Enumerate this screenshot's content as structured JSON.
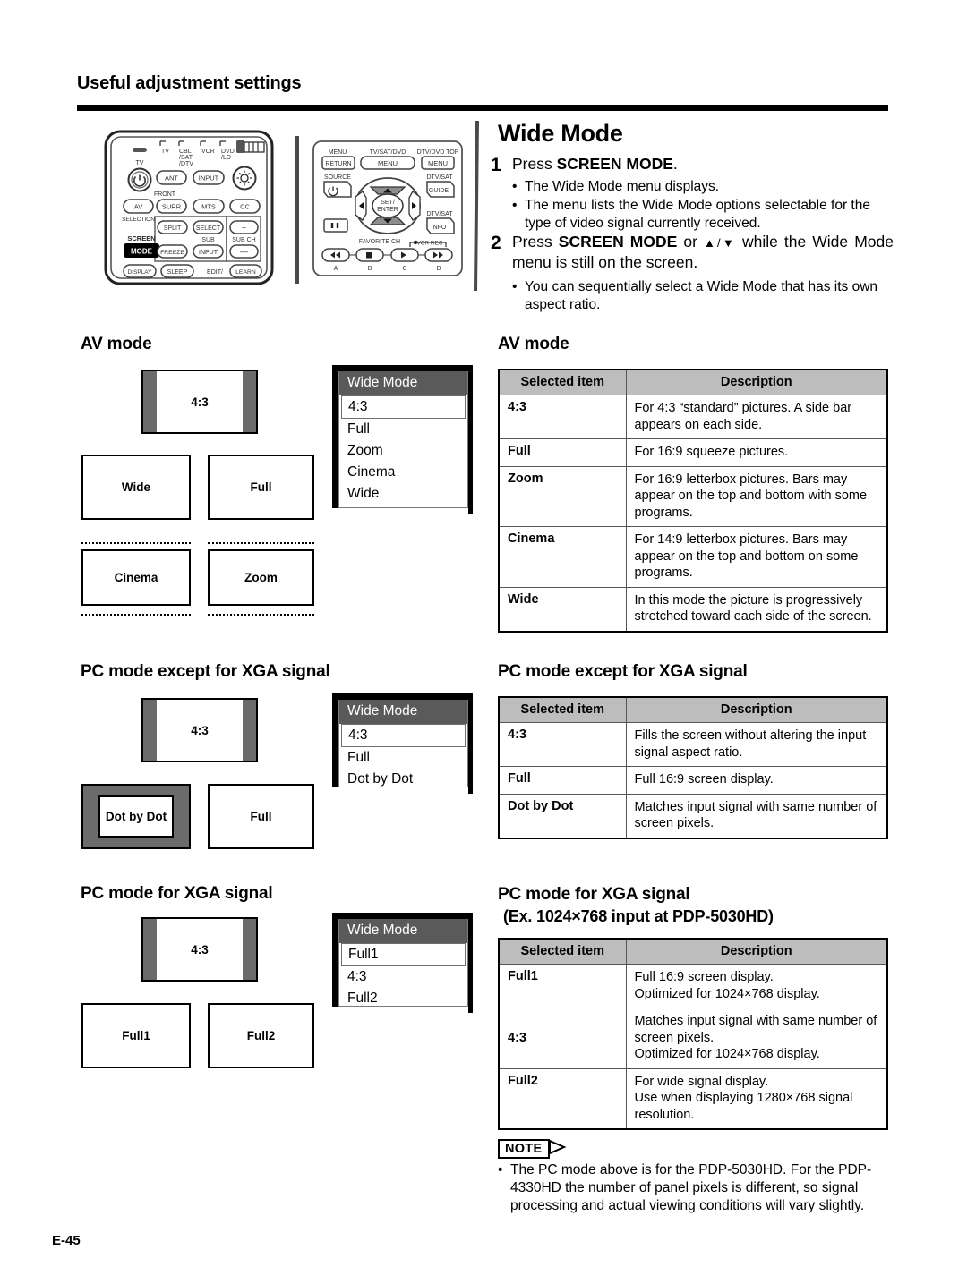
{
  "header": {
    "title": "Useful adjustment settings"
  },
  "instructions": {
    "heading": "Wide Mode",
    "step1": {
      "num": "1",
      "text_pre": "Press ",
      "text_bold": "SCREEN MODE",
      "text_post": ".",
      "bullets": [
        "The Wide Mode menu displays.",
        "The menu lists the Wide Mode options selectable for the type of video signal currently received."
      ]
    },
    "step2": {
      "num": "2",
      "text_pre": "Press ",
      "text_bold": "SCREEN MODE",
      "text_mid": " or ",
      "arrows": "▲/▼",
      "text_post": " while the Wide Mode menu is still on the screen.",
      "bullets": [
        "You can sequentially select a Wide Mode that has its own aspect ratio."
      ]
    }
  },
  "remote_left": {
    "labels": {
      "tv_small": "TV",
      "tv": "TV",
      "cbl": "CBL",
      "cbl2": "/SAT",
      "cbl3": "/DTV",
      "vcr": "VCR",
      "dvd": "DVD",
      "dvd2": "/LD",
      "ant": "ANT",
      "input": "INPUT",
      "av": "AV",
      "selection": "SELECTION",
      "front": "FRONT",
      "surr": "SURR",
      "mts": "MTS",
      "cc": "CC",
      "split": "SPLIT",
      "select": "SELECT",
      "plus": "+",
      "minus": "−",
      "sub": "SUB",
      "subch": "SUB CH",
      "screen": "SCREEN",
      "mode": "MODE",
      "freeze": "FREEZE",
      "input2": "INPUT",
      "display": "DISPLAY",
      "sleep": "SLEEP",
      "edit": "EDIT/",
      "learn": "LEARN"
    }
  },
  "remote_right": {
    "labels": {
      "menu": "MENU",
      "return": "RETURN",
      "tvsatdvd": "TV/SAT/DVD",
      "menu_btn": "MENU",
      "dtvdvdtop": "DTV/DVD TOP",
      "menu_btn2": "MENU",
      "source": "SOURCE",
      "dtvsat": "DTV/SAT",
      "guide": "GUIDE",
      "setenter1": "SET/",
      "setenter2": "ENTER",
      "dtvsat2": "DTV/SAT",
      "info": "INFO",
      "favorite": "FAVORITE CH",
      "vcrrec": "VCR REC",
      "a": "A",
      "b": "B",
      "c": "C",
      "d": "D"
    }
  },
  "sections": [
    {
      "id": "av-mode",
      "heading": "AV mode",
      "heading_right": "AV mode",
      "heading_right_sub": null,
      "preview_top": {
        "label": "4:3",
        "style": "sidebars"
      },
      "previews": [
        {
          "label": "Wide",
          "style": "plain"
        },
        {
          "label": "Full",
          "style": "plain"
        },
        {
          "label": "Cinema",
          "style": "dotted"
        },
        {
          "label": "Zoom",
          "style": "dotted"
        }
      ],
      "osd": {
        "title": "Wide Mode",
        "items": [
          "4:3",
          "Full",
          "Zoom",
          "Cinema",
          "Wide"
        ],
        "selected_index": 0
      },
      "table": {
        "col1": "Selected item",
        "col2": "Description",
        "rows": [
          {
            "item": "4:3",
            "desc": "For 4:3 “standard” pictures. A side bar appears on each side."
          },
          {
            "item": "Full",
            "desc": "For 16:9 squeeze pictures."
          },
          {
            "item": "Zoom",
            "desc": "For 16:9 letterbox pictures. Bars may appear on the top and bottom with some programs."
          },
          {
            "item": "Cinema",
            "desc": "For 14:9 letterbox pictures. Bars may appear on the top and bottom on some programs."
          },
          {
            "item": "Wide",
            "desc": "In this mode the picture is progressively stretched toward each side of the screen."
          }
        ]
      }
    },
    {
      "id": "pc-mode-except-xga",
      "heading": "PC mode except for XGA signal",
      "heading_right": "PC mode except for XGA signal",
      "heading_right_sub": null,
      "preview_top": {
        "label": "4:3",
        "style": "sidebars"
      },
      "previews": [
        {
          "label": "Dot by Dot",
          "style": "framed"
        },
        {
          "label": "Full",
          "style": "plain"
        }
      ],
      "osd": {
        "title": "Wide Mode",
        "items": [
          "4:3",
          "Full",
          "Dot by Dot"
        ],
        "selected_index": 0
      },
      "table": {
        "col1": "Selected item",
        "col2": "Description",
        "rows": [
          {
            "item": "4:3",
            "desc": "Fills the screen without altering the input signal aspect ratio."
          },
          {
            "item": "Full",
            "desc": "Full 16:9 screen display."
          },
          {
            "item": "Dot by Dot",
            "desc": "Matches input signal with same number of screen pixels."
          }
        ]
      }
    },
    {
      "id": "pc-mode-xga",
      "heading": "PC mode for XGA signal",
      "heading_right": "PC mode for XGA signal",
      "heading_right_sub": "(Ex. 1024×768 input at PDP-5030HD)",
      "preview_top": {
        "label": "4:3",
        "style": "sidebars"
      },
      "previews": [
        {
          "label": "Full1",
          "style": "plain"
        },
        {
          "label": "Full2",
          "style": "plain"
        }
      ],
      "osd": {
        "title": "Wide Mode",
        "items": [
          "Full1",
          "4:3",
          "Full2"
        ],
        "selected_index": 0
      },
      "table": {
        "col1": "Selected item",
        "col2": "Description",
        "rows": [
          {
            "item": "Full1",
            "desc": "Full 16:9 screen display.\nOptimized for 1024×768 display."
          },
          {
            "item": "4:3",
            "desc": "Matches input signal with same number of screen pixels.\nOptimized for 1024×768 display."
          },
          {
            "item": "Full2",
            "desc": "For wide signal display.\nUse when displaying 1280×768 signal resolution."
          }
        ]
      }
    }
  ],
  "note": {
    "tag": "NOTE",
    "text": "The PC mode above is for the PDP-5030HD. For the PDP-4330HD the number of panel  pixels is different, so  signal processing and actual viewing conditions will vary slightly."
  },
  "footer": {
    "page": "E-45"
  },
  "colors": {
    "gray_bar": "#6b6b6b",
    "osd_header": "#5a5a5a",
    "table_header": "#bdbdbd",
    "rule": "#000000"
  }
}
